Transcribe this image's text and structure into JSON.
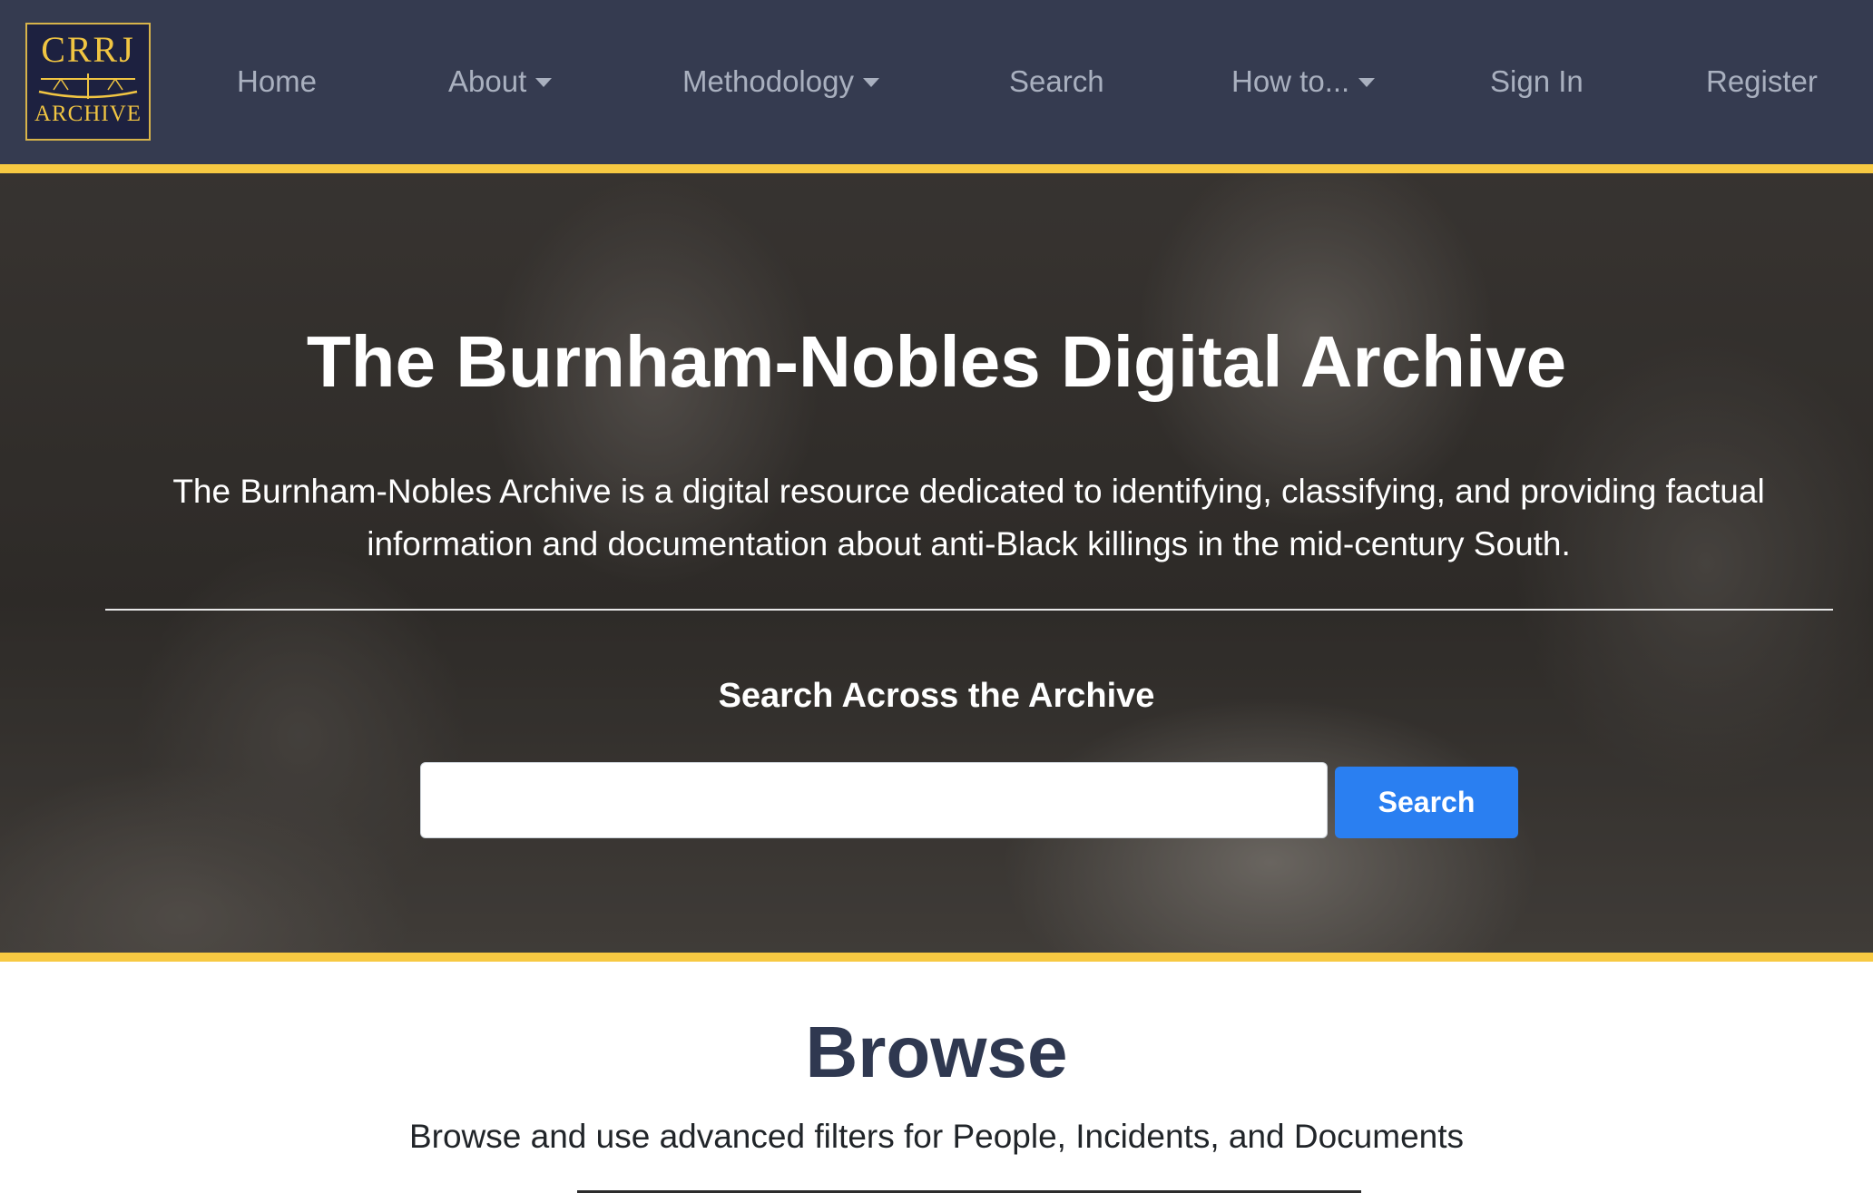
{
  "logo": {
    "top_text": "CRRJ",
    "bottom_text": "ARCHIVE",
    "icon": "scales-of-justice-icon"
  },
  "nav": {
    "items": [
      {
        "label": "Home",
        "dropdown": false
      },
      {
        "label": "About",
        "dropdown": true
      },
      {
        "label": "Methodology",
        "dropdown": true
      },
      {
        "label": "Search",
        "dropdown": false
      },
      {
        "label": "How to...",
        "dropdown": true
      },
      {
        "label": "Sign In",
        "dropdown": false
      },
      {
        "label": "Register",
        "dropdown": false
      }
    ]
  },
  "hero": {
    "title": "The Burnham-Nobles Digital Archive",
    "description": "The Burnham-Nobles Archive is a digital resource dedicated to identifying, classifying, and providing factual information and documentation about anti-Black killings in the mid-century South.",
    "search_heading": "Search Across the Archive",
    "search_value": "",
    "search_button_label": "Search"
  },
  "browse": {
    "title": "Browse",
    "description": "Browse and use advanced filters for People, Incidents, and Documents"
  },
  "colors": {
    "navbar_bg": "#353b50",
    "accent_gold": "#f7c942",
    "primary_blue": "#2a7ff1",
    "heading_navy": "#2f3850"
  }
}
